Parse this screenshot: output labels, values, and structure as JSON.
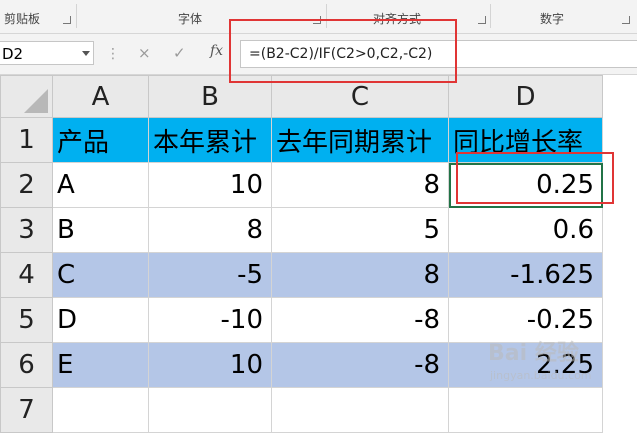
{
  "ribbon": {
    "groups": [
      "剪贴板",
      "字体",
      "对齐方式",
      "数字"
    ]
  },
  "formula_bar": {
    "name_box": "D2",
    "cancel_icon": "×",
    "enter_icon": "✓",
    "fx_label": "fx",
    "formula": "=(B2-C2)/IF(C2>0,C2,-C2)"
  },
  "columns": [
    "A",
    "B",
    "C",
    "D"
  ],
  "rows": [
    {
      "num": "1",
      "cells": [
        "产品",
        "本年累计",
        "去年同期累计",
        "同比增长率"
      ]
    },
    {
      "num": "2",
      "cells": [
        "A",
        "10",
        "8",
        "0.25"
      ]
    },
    {
      "num": "3",
      "cells": [
        "B",
        "8",
        "5",
        "0.6"
      ]
    },
    {
      "num": "4",
      "cells": [
        "C",
        "-5",
        "8",
        "-1.625"
      ]
    },
    {
      "num": "5",
      "cells": [
        "D",
        "-10",
        "-8",
        "-0.25"
      ]
    },
    {
      "num": "6",
      "cells": [
        "E",
        "10",
        "-8",
        "2.25"
      ]
    },
    {
      "num": "7",
      "cells": [
        "",
        "",
        "",
        ""
      ]
    }
  ],
  "colors": {
    "header_fill": "#00b0f0",
    "band_fill": "#b4c6e7",
    "highlight": "#e03535"
  },
  "watermark": {
    "logo": "Bai 经验",
    "site": "jingyan.baidu.com"
  }
}
